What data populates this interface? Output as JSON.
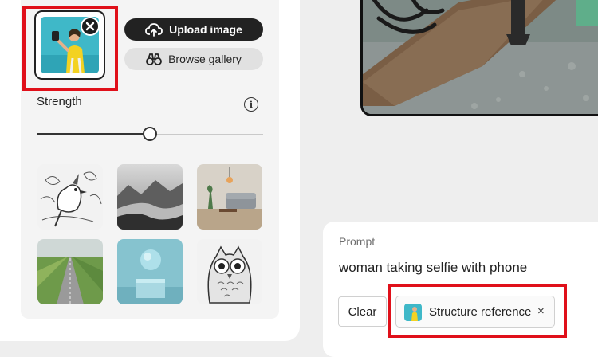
{
  "reference_panel": {
    "upload_label": "Upload image",
    "gallery_label": "Browse gallery",
    "strength_label": "Strength",
    "strength_value": 0.5
  },
  "gallery": {
    "tiles": [
      {
        "name": "bird-sketch"
      },
      {
        "name": "mountain-lake"
      },
      {
        "name": "living-room"
      },
      {
        "name": "field-road"
      },
      {
        "name": "sphere-pedestal"
      },
      {
        "name": "owl-sketch"
      }
    ]
  },
  "prompt": {
    "label": "Prompt",
    "text": "woman taking selfie with phone",
    "clear_label": "Clear",
    "chip_label": "Structure reference",
    "chip_close": "×"
  },
  "colors": {
    "highlight": "#e0101a",
    "dark_button": "#222222",
    "accent_teal": "#3fb8c8"
  }
}
